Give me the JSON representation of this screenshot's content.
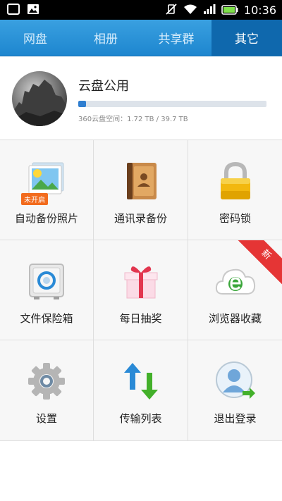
{
  "status_bar": {
    "time": "10:36"
  },
  "tabs": [
    {
      "label": "网盘",
      "active": false
    },
    {
      "label": "相册",
      "active": false
    },
    {
      "label": "共享群",
      "active": false
    },
    {
      "label": "其它",
      "active": true
    }
  ],
  "account": {
    "name": "云盘公用",
    "quota_text": "360云盘空间：1.72 TB / 39.7 TB",
    "quota_fraction": 0.043
  },
  "grid": [
    {
      "label": "自动备份照片",
      "icon": "photo-backup-icon",
      "badge": "未开启"
    },
    {
      "label": "通讯录备份",
      "icon": "contacts-book-icon"
    },
    {
      "label": "密码锁",
      "icon": "padlock-icon"
    },
    {
      "label": "文件保险箱",
      "icon": "safe-icon"
    },
    {
      "label": "每日抽奖",
      "icon": "gift-box-icon"
    },
    {
      "label": "浏览器收藏",
      "icon": "browser-cloud-icon",
      "ribbon": "新"
    },
    {
      "label": "设置",
      "icon": "gear-icon"
    },
    {
      "label": "传输列表",
      "icon": "transfer-arrows-icon"
    },
    {
      "label": "退出登录",
      "icon": "logout-user-icon"
    }
  ],
  "colors": {
    "tab_bar": "#1d86cf",
    "tab_active": "#0f68ad",
    "quota_fill": "#2f7ed0",
    "new_ribbon": "#e53535"
  }
}
